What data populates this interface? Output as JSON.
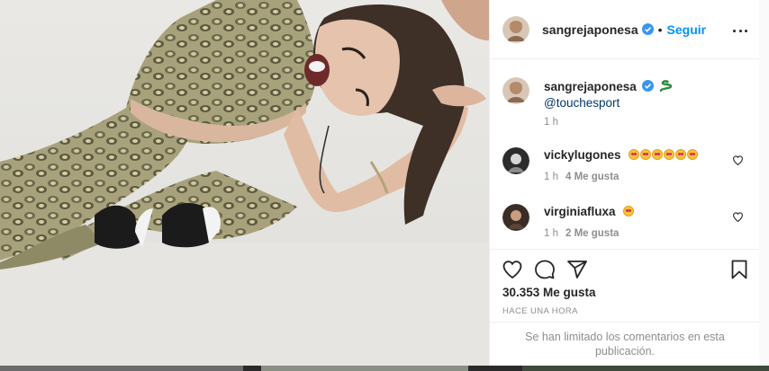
{
  "post": {
    "username": "sangrejaponesa",
    "follow_label": "Seguir",
    "separator": "•"
  },
  "caption": {
    "username": "sangrejaponesa",
    "mention": "@touchesport",
    "time": "1 h"
  },
  "comments": [
    {
      "username": "vickylugones",
      "emoji_count": 6,
      "time": "1 h",
      "likes": "4 Me gusta"
    },
    {
      "username": "virginiafluxa",
      "emoji_count": 1,
      "time": "1 h",
      "likes": "2 Me gusta"
    }
  ],
  "stats": {
    "likes": "30.353 Me gusta",
    "posted_ago": "HACE UNA HORA"
  },
  "footer": {
    "limited_comments": "Se han limitado los comentarios en esta publicación."
  },
  "colors": {
    "link_blue": "#0095f6",
    "mention_blue": "#00376b",
    "verified_blue": "#3897f0",
    "muted": "#8e8e8e"
  },
  "icons": [
    "verified-icon",
    "more-options-icon",
    "heart-icon",
    "comment-icon",
    "share-icon",
    "bookmark-icon",
    "snake-icon",
    "heart-eyes-emoji"
  ]
}
